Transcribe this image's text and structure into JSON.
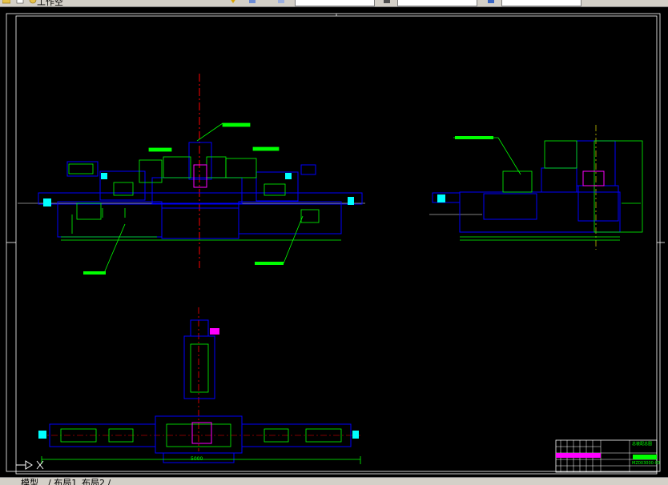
{
  "toolbar": {
    "title_fragment": "工作空",
    "layer_field_value": "",
    "style_field_value": "",
    "layer_dropdown_value": ""
  },
  "drawing": {
    "dimension_width_label": "5000",
    "title_block_name": "总装配总图",
    "title_block_code": "MZ003000-00",
    "colors": {
      "background": "#000000",
      "frame": "#ffffff",
      "outline": "#0000ff",
      "geometry": "#00ff00",
      "centerline": "#ff0000",
      "highlight": "#ff00ff",
      "cyan": "#00ffff"
    }
  },
  "layout_tabs": {
    "model": "模型",
    "layout1": "/ 布局1",
    "layout2": "布局2 /"
  },
  "ucs_icon": "ucs-icon"
}
